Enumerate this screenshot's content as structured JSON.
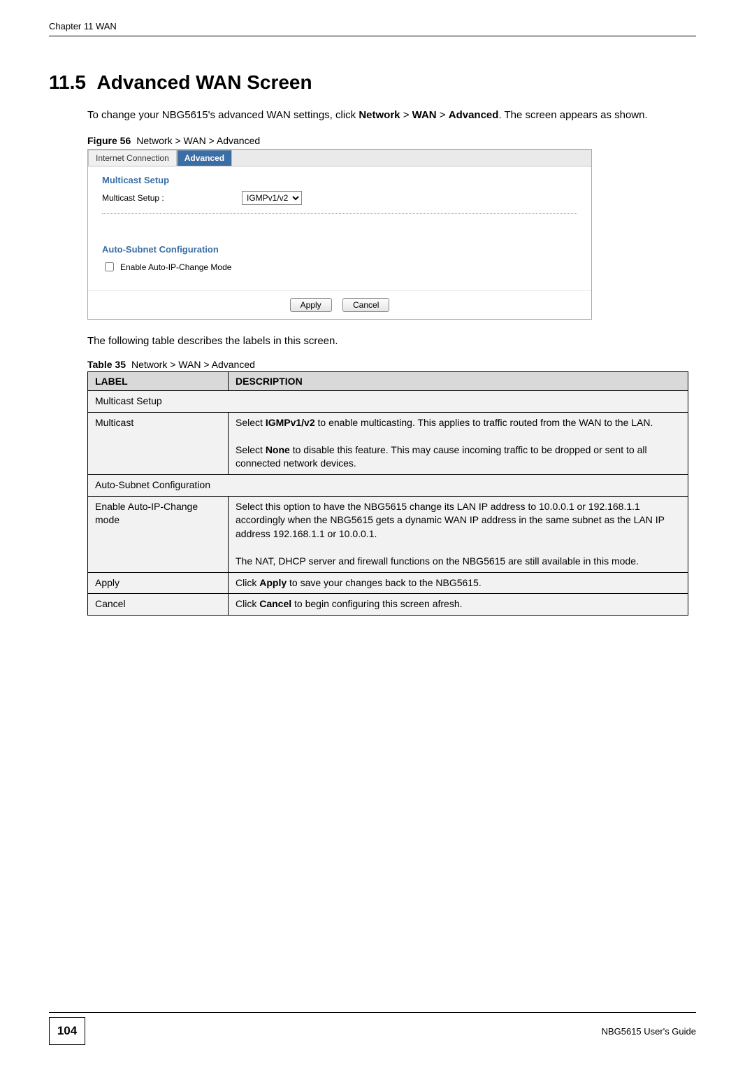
{
  "header": {
    "chapter": "Chapter 11 WAN"
  },
  "section": {
    "number": "11.5",
    "title": "Advanced WAN Screen"
  },
  "intro": {
    "line1": "To change your NBG5615's advanced WAN settings, click ",
    "nav1": "Network",
    "sep": " > ",
    "nav2": "WAN",
    "nav3": "Advanced",
    "line2": ". The screen appears as shown."
  },
  "figure": {
    "label": "Figure 56",
    "text": "Network > WAN > Advanced"
  },
  "screenshot": {
    "tabs": {
      "internet": "Internet Connection",
      "advanced": "Advanced"
    },
    "multicast": {
      "section_title": "Multicast Setup",
      "label": "Multicast Setup :",
      "select_value": "IGMPv1/v2"
    },
    "autosubnet": {
      "section_title": "Auto-Subnet Configuration",
      "checkbox_label": "Enable Auto-IP-Change Mode"
    },
    "buttons": {
      "apply": "Apply",
      "cancel": "Cancel"
    }
  },
  "following_text": "The following table describes the labels in this screen.",
  "table_caption": {
    "label": "Table 35",
    "text": "Network > WAN > Advanced"
  },
  "table": {
    "headers": {
      "label": "LABEL",
      "description": "DESCRIPTION"
    },
    "rows": {
      "multicast_setup_section": "Multicast Setup",
      "multicast": {
        "label": "Multicast",
        "desc_part1": "Select ",
        "desc_bold1": "IGMPv1/v2",
        "desc_part2": " to enable multicasting. This applies to traffic routed from the WAN to the LAN.",
        "desc_part3": "Select ",
        "desc_bold2": "None",
        "desc_part4": " to disable this feature. This may cause incoming traffic to be dropped or sent to all connected network devices."
      },
      "autosubnet_section": "Auto-Subnet Configuration",
      "enable_auto": {
        "label": "Enable Auto-IP-Change mode",
        "desc_part1": "Select this option to have the NBG5615 change its LAN IP address to 10.0.0.1 or 192.168.1.1 accordingly when the NBG5615 gets a dynamic WAN IP address in the same subnet as the LAN IP address 192.168.1.1 or 10.0.0.1.",
        "desc_part2": "The NAT, DHCP server and firewall functions on the NBG5615 are still available in this mode."
      },
      "apply": {
        "label": "Apply",
        "desc_part1": "Click ",
        "desc_bold": "Apply",
        "desc_part2": " to save your changes back to the NBG5615."
      },
      "cancel": {
        "label": "Cancel",
        "desc_part1": "Click ",
        "desc_bold": "Cancel",
        "desc_part2": " to begin configuring this screen afresh."
      }
    }
  },
  "footer": {
    "page": "104",
    "guide": "NBG5615 User's Guide"
  }
}
